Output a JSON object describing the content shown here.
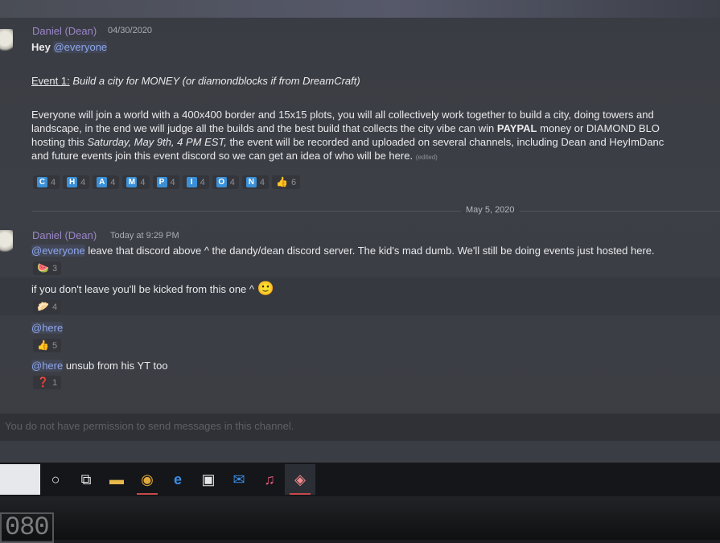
{
  "message_group_1": {
    "author": "Daniel (Dean)",
    "timestamp": "04/30/2020",
    "line_hey_prefix": "Hey",
    "line_hey_mention": "@everyone",
    "event_label": "Event 1:",
    "event_title": "Build a city for MONEY (or diamondblocks if from DreamCraft)",
    "body_line1": "Everyone will join a world with a 400x400 border and 15x15 plots, you will all collectively work together to build a city, doing towers and",
    "body_line2_a": "landscape, in the end we will judge all the builds and the best build that collects the city vibe can win",
    "body_line2_bold": "PAYPAL",
    "body_line2_b": "money or DIAMOND BLO",
    "body_line3_a": "hosting this",
    "body_line3_italic": "Saturday, May 9th, 4 PM EST,",
    "body_line3_b": "the event will be recorded and uploaded on several channels, including Dean and HeyImDanc",
    "body_line4": "and future events join this event discord so we can get an idea of who will be here.",
    "edited_tag": "(edited)",
    "reactions": [
      {
        "glyph": "C",
        "count": "4"
      },
      {
        "glyph": "H",
        "count": "4"
      },
      {
        "glyph": "A",
        "count": "4"
      },
      {
        "glyph": "M",
        "count": "4"
      },
      {
        "glyph": "P",
        "count": "4"
      },
      {
        "glyph": "I",
        "count": "4"
      },
      {
        "glyph": "O",
        "count": "4"
      },
      {
        "glyph": "N",
        "count": "4"
      },
      {
        "glyph": "👍",
        "count": "6"
      }
    ]
  },
  "date_divider": "May 5, 2020",
  "message_group_2": {
    "author": "Daniel (Dean)",
    "timestamp": "Today at 9:29 PM",
    "msg1_mention": "@everyone",
    "msg1_text": "leave that discord above ^ the dandy/dean discord server. The kid's mad dumb. We'll still be doing events just hosted here.",
    "msg1_reaction": {
      "glyph": "🍉",
      "count": "3"
    },
    "msg2_text": "if you don't leave you'll be kicked from this one ^",
    "msg2_emoji": "🙂",
    "msg2_reaction": {
      "glyph": "🥟",
      "count": "4"
    },
    "msg3_mention": "@here",
    "msg3_reaction": {
      "glyph": "👍",
      "count": "5"
    },
    "msg4_mention": "@here",
    "msg4_text": "unsub from his YT too",
    "msg4_reaction": {
      "glyph": "❓",
      "count": "1"
    }
  },
  "composer": {
    "placeholder": "You do not have permission to send messages in this channel."
  },
  "taskbar": {
    "items": [
      {
        "name": "cortana",
        "glyph": "○"
      },
      {
        "name": "task-view",
        "glyph": "⧉"
      },
      {
        "name": "file-explorer",
        "glyph": "▬"
      },
      {
        "name": "chrome",
        "glyph": "◉"
      },
      {
        "name": "edge",
        "glyph": "e"
      },
      {
        "name": "store",
        "glyph": "▣"
      },
      {
        "name": "mail",
        "glyph": "✉"
      },
      {
        "name": "itunes",
        "glyph": "♫"
      },
      {
        "name": "discord",
        "glyph": "◈"
      }
    ]
  },
  "monitor_label": "080"
}
